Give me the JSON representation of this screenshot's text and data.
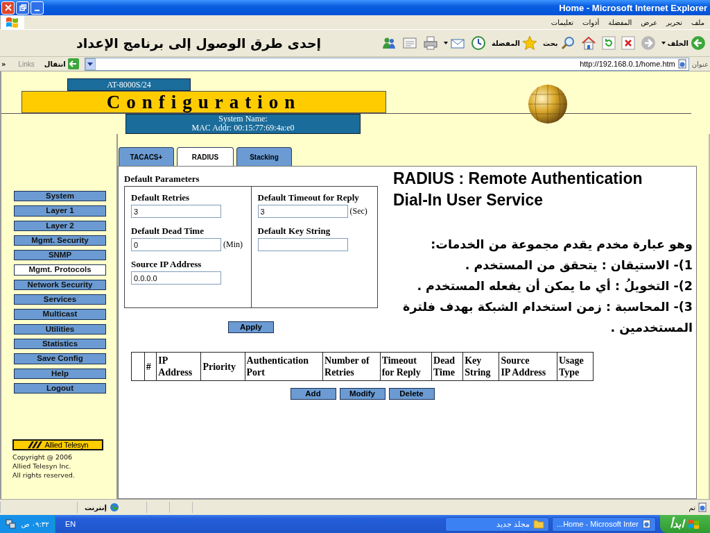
{
  "window": {
    "title": "Home - Microsoft Internet Explorer"
  },
  "menu": [
    "ملف",
    "تحرير",
    "عرض",
    "المفضلة",
    "أدوات",
    "تعليمات"
  ],
  "toolbar": {
    "back_label": "الخلف",
    "search_label": "بحث",
    "favorites_label": "المفضلة"
  },
  "annotation": "إحدى طرق الوصول إلى برنامج الإعداد",
  "address_bar": {
    "label": "عنوان",
    "url": "http://192.168.0.1/home.htm",
    "go_label": "انتقال",
    "links_label": "Links",
    "more": "»"
  },
  "page": {
    "model": "AT-8000S/24",
    "heading": "Configuration",
    "system_name": "System Name:",
    "mac": "MAC Addr:  00:15:77:69:4a:e0",
    "nav": [
      {
        "label": "System",
        "selected": false
      },
      {
        "label": "Layer 1",
        "selected": false
      },
      {
        "label": "Layer 2",
        "selected": false
      },
      {
        "label": "Mgmt. Security",
        "selected": false
      },
      {
        "label": "SNMP",
        "selected": false
      },
      {
        "label": "Mgmt. Protocols",
        "selected": true
      },
      {
        "label": "Network Security",
        "selected": false
      },
      {
        "label": "Services",
        "selected": false
      },
      {
        "label": "Multicast",
        "selected": false
      },
      {
        "label": "Utilities",
        "selected": false
      },
      {
        "label": "Statistics",
        "selected": false
      },
      {
        "label": "Save Config",
        "selected": false
      },
      {
        "label": "Help",
        "selected": false
      },
      {
        "label": "Logout",
        "selected": false
      }
    ],
    "brand": "Allied Telesyn",
    "copyright": [
      "Copyright @ 2006",
      "Allied Telesyn Inc.",
      "All rights reserved."
    ],
    "tabs": [
      {
        "label": "TACACS+",
        "selected": false
      },
      {
        "label": "RADIUS",
        "selected": true
      },
      {
        "label": "Stacking",
        "selected": false
      }
    ],
    "section_title": "Default Parameters",
    "left_fields": [
      {
        "label": "Default Retries",
        "value": "3"
      },
      {
        "label": "Default Dead Time",
        "value": "0",
        "unit": "(Min)"
      },
      {
        "label": "Source IP Address",
        "value": "0.0.0.0"
      }
    ],
    "right_fields": [
      {
        "label": "Default Timeout for Reply",
        "value": "3",
        "unit": "(Sec)"
      },
      {
        "label": "Default Key String"
      }
    ],
    "apply": "Apply",
    "table": {
      "columns": [
        "#",
        "IP\nAddress",
        "Priority",
        "Authentication\nPort",
        "Number of\nRetries",
        "Timeout\nfor Reply",
        "Dead\nTime",
        "Key\nString",
        "Source\nIP Address",
        "Usage\nType"
      ]
    },
    "actions": [
      "Add",
      "Modify",
      "Delete"
    ],
    "info": {
      "title": "RADIUS : Remote Authentication Dial-In User Service",
      "intro": "وهو عبارة مخدم يقدم مجموعة من الخدمات:",
      "items": [
        "1)- الاستيقان : يتحقق من المستخدم .",
        "2)- التخويلُ : أي ما يمكن أن يفعله المستخدم .",
        "3)- المحاسبة : زمن استخدام الشبكة بهدف فلترة المستخدمين ."
      ]
    }
  },
  "status_bar": {
    "status": "تم",
    "zone": "إنترنت"
  },
  "taskbar": {
    "start": "ابدأ",
    "tasks": [
      "مجلد جديد",
      "...Home - Microsoft Inter"
    ],
    "language": "EN",
    "clock": "٠٩:٣٢ ص"
  }
}
